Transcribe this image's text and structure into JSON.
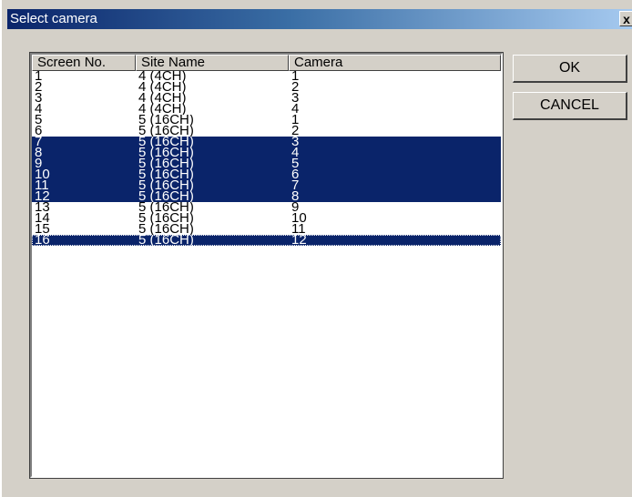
{
  "window": {
    "title": "Select camera",
    "close_glyph": "x"
  },
  "list": {
    "columns": [
      "Screen No.",
      "Site Name",
      "Camera"
    ],
    "rows": [
      {
        "screen": "1",
        "site": "4 (4CH)",
        "camera": "1",
        "selected": false
      },
      {
        "screen": "2",
        "site": "4 (4CH)",
        "camera": "2",
        "selected": false
      },
      {
        "screen": "3",
        "site": "4 (4CH)",
        "camera": "3",
        "selected": false
      },
      {
        "screen": "4",
        "site": "4 (4CH)",
        "camera": "4",
        "selected": false
      },
      {
        "screen": "5",
        "site": "5 (16CH)",
        "camera": "1",
        "selected": false
      },
      {
        "screen": "6",
        "site": "5 (16CH)",
        "camera": "2",
        "selected": false
      },
      {
        "screen": "7",
        "site": "5 (16CH)",
        "camera": "3",
        "selected": true
      },
      {
        "screen": "8",
        "site": "5 (16CH)",
        "camera": "4",
        "selected": true
      },
      {
        "screen": "9",
        "site": "5 (16CH)",
        "camera": "5",
        "selected": true
      },
      {
        "screen": "10",
        "site": "5 (16CH)",
        "camera": "6",
        "selected": true
      },
      {
        "screen": "11",
        "site": "5 (16CH)",
        "camera": "7",
        "selected": true
      },
      {
        "screen": "12",
        "site": "5 (16CH)",
        "camera": "8",
        "selected": true
      },
      {
        "screen": "13",
        "site": "5 (16CH)",
        "camera": "9",
        "selected": false
      },
      {
        "screen": "14",
        "site": "5 (16CH)",
        "camera": "10",
        "selected": false
      },
      {
        "screen": "15",
        "site": "5 (16CH)",
        "camera": "11",
        "selected": false
      },
      {
        "screen": "16",
        "site": "5 (16CH)",
        "camera": "12",
        "selected": true,
        "focused": true
      }
    ]
  },
  "buttons": {
    "ok_label": "OK",
    "cancel_label": "CANCEL"
  },
  "colors": {
    "dialog_bg": "#d4d0c8",
    "titlebar_start": "#0a246a",
    "titlebar_end": "#a6caf0",
    "selection_bg": "#0a246a",
    "selection_text": "#ffffff"
  }
}
